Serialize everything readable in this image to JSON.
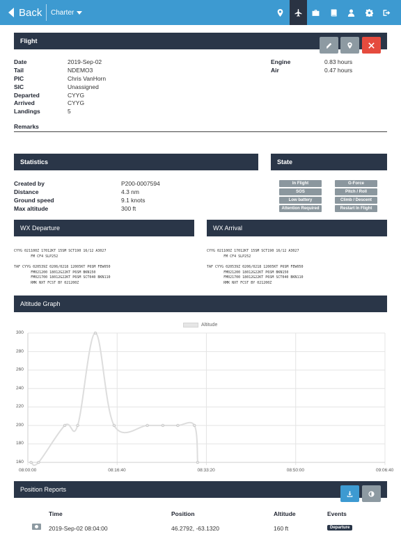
{
  "nav": {
    "back_label": "Back",
    "context_label": "Charter",
    "icons": [
      "map-marker-icon",
      "airplane-icon",
      "briefcase-icon",
      "book-icon",
      "user-icon",
      "gear-icon",
      "sign-out-icon"
    ],
    "active_icon": "airplane-icon"
  },
  "flight": {
    "title": "Flight",
    "fields": [
      {
        "label": "Date",
        "value": "2019-Sep-02"
      },
      {
        "label": "Tail",
        "value": "NDEMO3"
      },
      {
        "label": "PIC",
        "value": "Chris VanHorn"
      },
      {
        "label": "SIC",
        "value": "Unassigned"
      },
      {
        "label": "Departed",
        "value": "CYYG"
      },
      {
        "label": "Arrived",
        "value": "CYYG"
      },
      {
        "label": "Landings",
        "value": "5"
      }
    ],
    "times": [
      {
        "label": "Engine",
        "value": "0.83 hours"
      },
      {
        "label": "Air",
        "value": "0.47 hours"
      }
    ],
    "remarks_label": "Remarks"
  },
  "statistics": {
    "title": "Statistics",
    "fields": [
      {
        "label": "Created by",
        "value": "P200-0007594"
      },
      {
        "label": "Distance",
        "value": "4.3 nm"
      },
      {
        "label": "Ground speed",
        "value": "9.1 knots"
      },
      {
        "label": "Max altitude",
        "value": "300 ft"
      }
    ]
  },
  "state": {
    "title": "State",
    "tags": [
      "In Flight",
      "G-Force",
      "SOS",
      "Pitch / Roll",
      "Low battery",
      "Climb / Descent",
      "Attention Required",
      "Restart In Flight"
    ]
  },
  "wx_departure": {
    "title": "WX Departure",
    "metar": "CYYG 021100Z 17012KT 15SM SCT190 16/12 A3027\n        FM CF4 SLP252",
    "taf": "TAF CYYG 020539Z 0206/0218 12005KT P6SM FEW050\n        FM021200 18012G22KT P6SM BKN150\n        FM021700 18012G22KT P6SM SCT040 BKN110\n        RMK NXT FCST BY 021200Z"
  },
  "wx_arrival": {
    "title": "WX Arrival",
    "metar": "CYYG 021100Z 17012KT 15SM SCT190 16/12 A3027\n        FM CF4 SLP252",
    "taf": "TAF CYYG 020539Z 0206/0218 12005KT P6SM FEW050\n        FM021200 18012G22KT P6SM BKN150\n        FM021700 18012G22KT P6SM SCT040 BKN110\n        RMK NXT FCST BY 021200Z"
  },
  "altitude_graph": {
    "title": "Altitude Graph"
  },
  "chart_data": {
    "type": "line",
    "series": [
      {
        "name": "Altitude",
        "points": [
          [
            0.6,
            160
          ],
          [
            2.0,
            160
          ],
          [
            6.9,
            200
          ],
          [
            9.3,
            200
          ],
          [
            12.6,
            300
          ],
          [
            16.1,
            200
          ],
          [
            22.3,
            200
          ],
          [
            25.2,
            200
          ],
          [
            28.0,
            200
          ],
          [
            31.1,
            200
          ],
          [
            31.7,
            160
          ]
        ]
      }
    ],
    "x_ticks": [
      "08:00:00",
      "08:16:40",
      "08:33:20",
      "08:50:00",
      "09:06:40"
    ],
    "x_tick_minutes": [
      0,
      16.67,
      33.33,
      50,
      66.67
    ],
    "xlim": [
      0,
      66.67
    ],
    "y_ticks": [
      160,
      180,
      200,
      220,
      240,
      260,
      280,
      300
    ],
    "ylim": [
      160,
      300
    ],
    "grid": true,
    "legend": "top-center",
    "color": "#dddddd"
  },
  "position_reports": {
    "title": "Position Reports",
    "columns": [
      "Time",
      "Position",
      "Altitude",
      "Events"
    ],
    "rows": [
      {
        "time": "2019-Sep-02 08:04:00",
        "position": "46.2792, -63.1320",
        "altitude": "160 ft",
        "event": "Departure"
      }
    ]
  }
}
